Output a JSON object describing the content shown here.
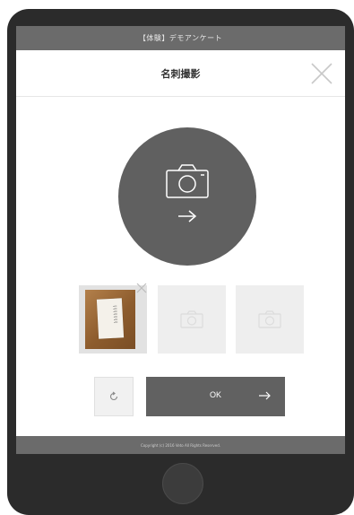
{
  "status_bar": {
    "title": "【体験】デモアンケート"
  },
  "header": {
    "title": "名刺撮影",
    "close_icon": "close-icon"
  },
  "capture": {
    "camera_icon": "camera-icon",
    "arrow_icon": "arrow-right-icon"
  },
  "thumbnails": [
    {
      "state": "filled",
      "remove_icon": "close-icon"
    },
    {
      "state": "empty",
      "icon": "camera-icon"
    },
    {
      "state": "empty",
      "icon": "camera-icon"
    }
  ],
  "actions": {
    "rotate_icon": "rotate-icon",
    "ok_label": "OK",
    "ok_arrow_icon": "arrow-right-icon"
  },
  "footer": {
    "copyright": "Copyright (c) 2016 Veto All Rights Reserved."
  },
  "colors": {
    "bezel": "#2b2b2b",
    "bar": "#6b6b6b",
    "accent": "#616161",
    "thumb_bg": "#eeeeee"
  }
}
